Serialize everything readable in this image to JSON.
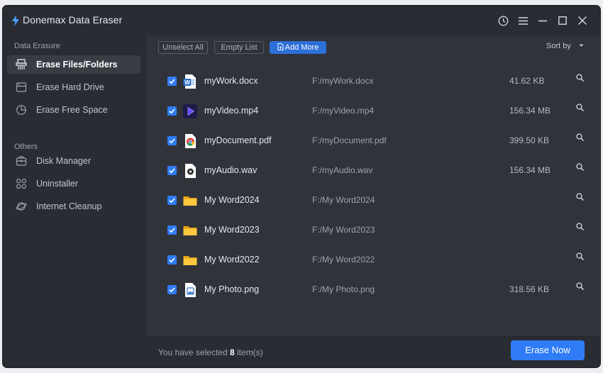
{
  "app": {
    "title": "Donemax Data Eraser",
    "accent": "#2f7cf6"
  },
  "titlebar_icons": [
    "history-icon",
    "menu-icon",
    "minimize-icon",
    "maximize-icon",
    "close-icon"
  ],
  "sidebar": {
    "sections": [
      {
        "label": "Data Erasure",
        "items": [
          {
            "label": "Erase Files/Folders",
            "icon": "shredder-icon",
            "active": true
          },
          {
            "label": "Erase Hard Drive",
            "icon": "hard-drive-icon",
            "active": false
          },
          {
            "label": "Erase Free Space",
            "icon": "pie-chart-icon",
            "active": false
          }
        ]
      },
      {
        "label": "Others",
        "items": [
          {
            "label": "Disk Manager",
            "icon": "disk-manager-icon",
            "active": false
          },
          {
            "label": "Uninstaller",
            "icon": "apps-icon",
            "active": false
          },
          {
            "label": "Internet Cleanup",
            "icon": "planet-icon",
            "active": false
          }
        ]
      }
    ]
  },
  "toolbar": {
    "unselect_all": "Unselect All",
    "empty_list": "Empty List",
    "add_more": "Add More",
    "sort_by": "Sort by"
  },
  "files": [
    {
      "name": "myWork.docx",
      "path": "F:/myWork.docx",
      "size": "41.62 KB",
      "type": "word",
      "checked": true
    },
    {
      "name": "myVideo.mp4",
      "path": "F:/myVideo.mp4",
      "size": "156.34 MB",
      "type": "video",
      "checked": true
    },
    {
      "name": "myDocument.pdf",
      "path": "F:/myDocument.pdf",
      "size": "399.50 KB",
      "type": "chrome",
      "checked": true
    },
    {
      "name": "myAudio.wav",
      "path": "F:/myAudio.wav",
      "size": "156.34 MB",
      "type": "audio",
      "checked": true
    },
    {
      "name": "My Word2024",
      "path": "F:/My Word2024",
      "size": "",
      "type": "folder",
      "checked": true
    },
    {
      "name": "My Word2023",
      "path": "F:/My Word2023",
      "size": "",
      "type": "folder",
      "checked": true
    },
    {
      "name": "My Word2022",
      "path": "F:/My Word2022",
      "size": "",
      "type": "folder",
      "checked": true
    },
    {
      "name": "My Photo.png",
      "path": "F:/My Photo.png",
      "size": "318.56 KB",
      "type": "image",
      "checked": true
    }
  ],
  "footer": {
    "selected_prefix": "You have selected",
    "selected_count": "8",
    "selected_suffix": "item(s)",
    "erase_now": "Erase Now"
  }
}
